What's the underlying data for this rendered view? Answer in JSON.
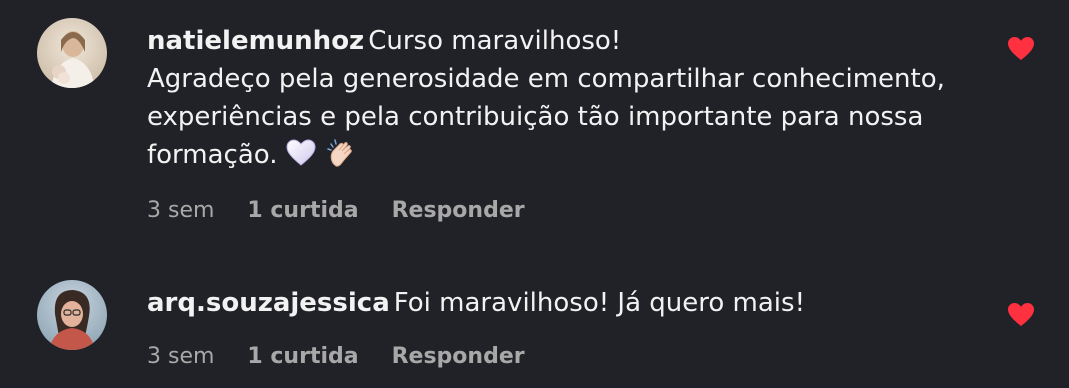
{
  "comments": [
    {
      "username": "natielemunhoz",
      "text_lines": [
        "Curso maravilhoso!",
        "Agradeço pela generosidade em compartilhar conhecimento,",
        "experiências e pela contribuição tão importante para nossa",
        "formação."
      ],
      "emojis": [
        "white-heart",
        "clapping-hands"
      ],
      "time": "3 sem",
      "likes": "1 curtida",
      "reply_label": "Responder",
      "liked": true
    },
    {
      "username": "arq.souzajessica",
      "text_lines": [
        "Foi maravilhoso! Já quero mais!"
      ],
      "time": "3 sem",
      "likes": "1 curtida",
      "reply_label": "Responder",
      "liked": true
    }
  ],
  "colors": {
    "background": "#212228",
    "text": "#f2f2f2",
    "meta": "#a8a8a8",
    "like": "#ff3040"
  },
  "icons": [
    "avatar-natielemunhoz",
    "avatar-arq-souzajessica",
    "heart-filled-icon"
  ]
}
